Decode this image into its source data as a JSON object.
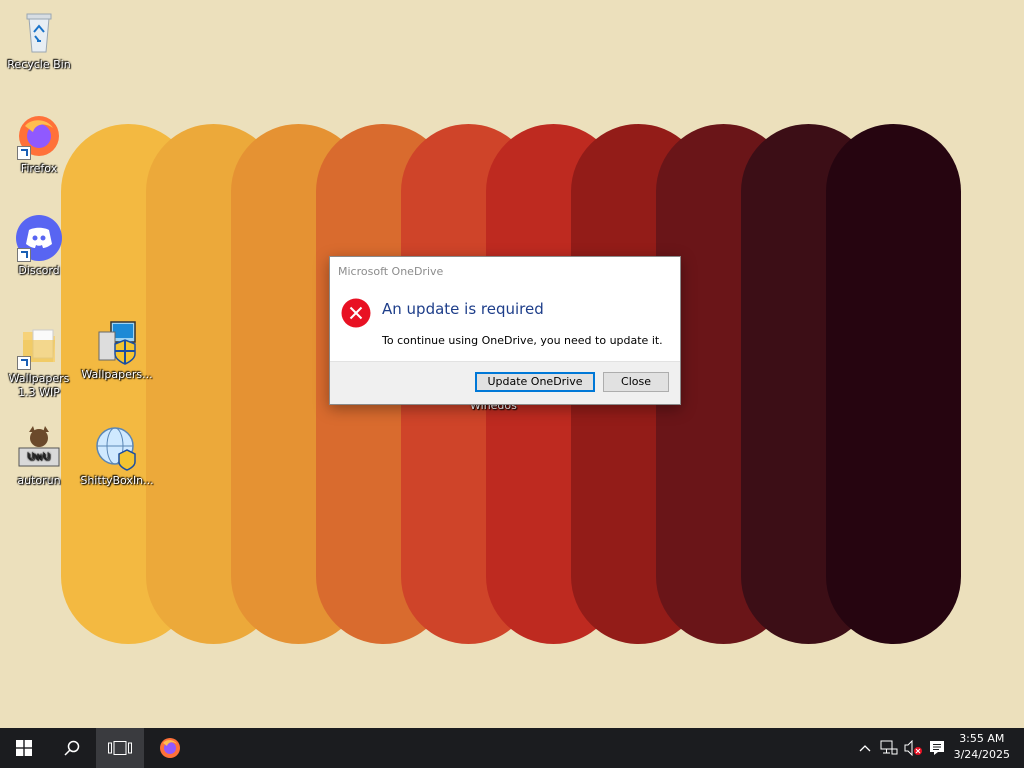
{
  "desktop": {
    "icons": [
      {
        "label": "Recycle Bin",
        "icon": "recycle-bin-icon"
      },
      {
        "label": "Firefox",
        "icon": "firefox-icon"
      },
      {
        "label": "Discord",
        "icon": "discord-icon"
      },
      {
        "label": "Wallpapers 1.3 WIP",
        "icon": "folder-icon"
      },
      {
        "label": "Wallpapers...",
        "icon": "installer-icon"
      },
      {
        "label": "autorun",
        "icon": "autorun-icon"
      },
      {
        "label": "ShittyBoxIn...",
        "icon": "installer-globe-icon"
      }
    ],
    "background_label": "Winedos",
    "wallpaper_colors": [
      "#f3b941",
      "#eca93a",
      "#e59233",
      "#d96b2e",
      "#cf4429",
      "#be2a20",
      "#931c18",
      "#6a1518",
      "#3c0e16",
      "#260510"
    ]
  },
  "dialog": {
    "title": "Microsoft OneDrive",
    "heading": "An update is required",
    "message": "To continue using OneDrive, you need to update it.",
    "update_label": "Update OneDrive",
    "close_label": "Close"
  },
  "taskbar": {
    "start_icon": "windows-logo-icon",
    "search_icon": "search-icon",
    "taskview_icon": "task-view-icon",
    "pinned_app": "firefox-icon",
    "time": "3:55 AM",
    "date": "3/24/2025"
  },
  "colors": {
    "accent": "#0078d7",
    "heading": "#1e3e8a",
    "error": "#e81123",
    "taskbar": "#1b1c1f"
  }
}
